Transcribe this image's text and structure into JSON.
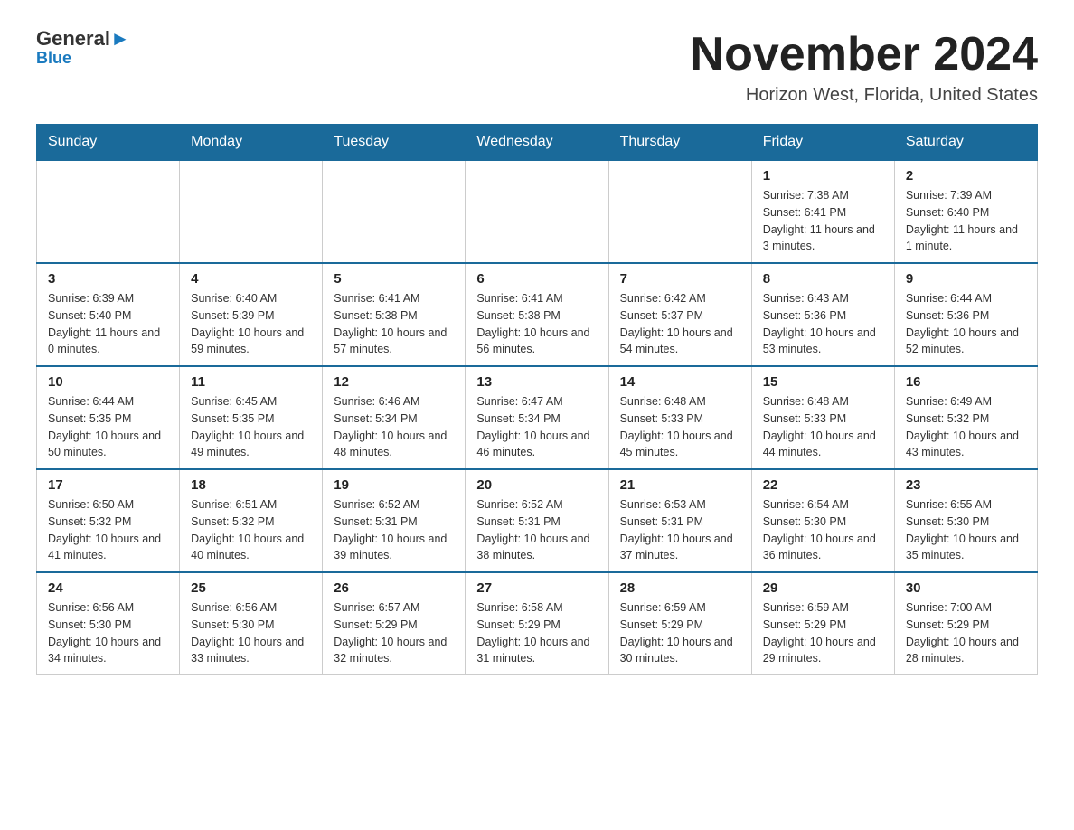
{
  "logo": {
    "text_black": "General",
    "text_blue": "Blue"
  },
  "title": "November 2024",
  "subtitle": "Horizon West, Florida, United States",
  "weekdays": [
    "Sunday",
    "Monday",
    "Tuesday",
    "Wednesday",
    "Thursday",
    "Friday",
    "Saturday"
  ],
  "weeks": [
    [
      {
        "day": "",
        "info": ""
      },
      {
        "day": "",
        "info": ""
      },
      {
        "day": "",
        "info": ""
      },
      {
        "day": "",
        "info": ""
      },
      {
        "day": "",
        "info": ""
      },
      {
        "day": "1",
        "info": "Sunrise: 7:38 AM\nSunset: 6:41 PM\nDaylight: 11 hours and 3 minutes."
      },
      {
        "day": "2",
        "info": "Sunrise: 7:39 AM\nSunset: 6:40 PM\nDaylight: 11 hours and 1 minute."
      }
    ],
    [
      {
        "day": "3",
        "info": "Sunrise: 6:39 AM\nSunset: 5:40 PM\nDaylight: 11 hours and 0 minutes."
      },
      {
        "day": "4",
        "info": "Sunrise: 6:40 AM\nSunset: 5:39 PM\nDaylight: 10 hours and 59 minutes."
      },
      {
        "day": "5",
        "info": "Sunrise: 6:41 AM\nSunset: 5:38 PM\nDaylight: 10 hours and 57 minutes."
      },
      {
        "day": "6",
        "info": "Sunrise: 6:41 AM\nSunset: 5:38 PM\nDaylight: 10 hours and 56 minutes."
      },
      {
        "day": "7",
        "info": "Sunrise: 6:42 AM\nSunset: 5:37 PM\nDaylight: 10 hours and 54 minutes."
      },
      {
        "day": "8",
        "info": "Sunrise: 6:43 AM\nSunset: 5:36 PM\nDaylight: 10 hours and 53 minutes."
      },
      {
        "day": "9",
        "info": "Sunrise: 6:44 AM\nSunset: 5:36 PM\nDaylight: 10 hours and 52 minutes."
      }
    ],
    [
      {
        "day": "10",
        "info": "Sunrise: 6:44 AM\nSunset: 5:35 PM\nDaylight: 10 hours and 50 minutes."
      },
      {
        "day": "11",
        "info": "Sunrise: 6:45 AM\nSunset: 5:35 PM\nDaylight: 10 hours and 49 minutes."
      },
      {
        "day": "12",
        "info": "Sunrise: 6:46 AM\nSunset: 5:34 PM\nDaylight: 10 hours and 48 minutes."
      },
      {
        "day": "13",
        "info": "Sunrise: 6:47 AM\nSunset: 5:34 PM\nDaylight: 10 hours and 46 minutes."
      },
      {
        "day": "14",
        "info": "Sunrise: 6:48 AM\nSunset: 5:33 PM\nDaylight: 10 hours and 45 minutes."
      },
      {
        "day": "15",
        "info": "Sunrise: 6:48 AM\nSunset: 5:33 PM\nDaylight: 10 hours and 44 minutes."
      },
      {
        "day": "16",
        "info": "Sunrise: 6:49 AM\nSunset: 5:32 PM\nDaylight: 10 hours and 43 minutes."
      }
    ],
    [
      {
        "day": "17",
        "info": "Sunrise: 6:50 AM\nSunset: 5:32 PM\nDaylight: 10 hours and 41 minutes."
      },
      {
        "day": "18",
        "info": "Sunrise: 6:51 AM\nSunset: 5:32 PM\nDaylight: 10 hours and 40 minutes."
      },
      {
        "day": "19",
        "info": "Sunrise: 6:52 AM\nSunset: 5:31 PM\nDaylight: 10 hours and 39 minutes."
      },
      {
        "day": "20",
        "info": "Sunrise: 6:52 AM\nSunset: 5:31 PM\nDaylight: 10 hours and 38 minutes."
      },
      {
        "day": "21",
        "info": "Sunrise: 6:53 AM\nSunset: 5:31 PM\nDaylight: 10 hours and 37 minutes."
      },
      {
        "day": "22",
        "info": "Sunrise: 6:54 AM\nSunset: 5:30 PM\nDaylight: 10 hours and 36 minutes."
      },
      {
        "day": "23",
        "info": "Sunrise: 6:55 AM\nSunset: 5:30 PM\nDaylight: 10 hours and 35 minutes."
      }
    ],
    [
      {
        "day": "24",
        "info": "Sunrise: 6:56 AM\nSunset: 5:30 PM\nDaylight: 10 hours and 34 minutes."
      },
      {
        "day": "25",
        "info": "Sunrise: 6:56 AM\nSunset: 5:30 PM\nDaylight: 10 hours and 33 minutes."
      },
      {
        "day": "26",
        "info": "Sunrise: 6:57 AM\nSunset: 5:29 PM\nDaylight: 10 hours and 32 minutes."
      },
      {
        "day": "27",
        "info": "Sunrise: 6:58 AM\nSunset: 5:29 PM\nDaylight: 10 hours and 31 minutes."
      },
      {
        "day": "28",
        "info": "Sunrise: 6:59 AM\nSunset: 5:29 PM\nDaylight: 10 hours and 30 minutes."
      },
      {
        "day": "29",
        "info": "Sunrise: 6:59 AM\nSunset: 5:29 PM\nDaylight: 10 hours and 29 minutes."
      },
      {
        "day": "30",
        "info": "Sunrise: 7:00 AM\nSunset: 5:29 PM\nDaylight: 10 hours and 28 minutes."
      }
    ]
  ]
}
